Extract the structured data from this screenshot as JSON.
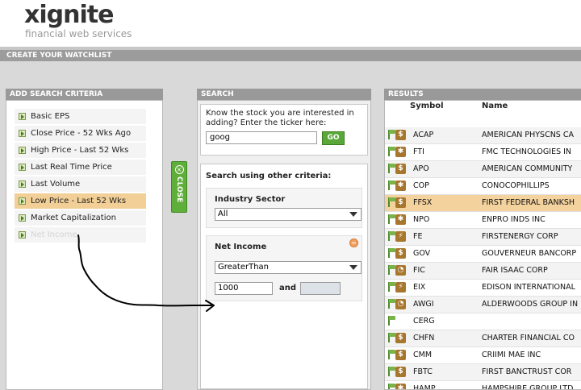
{
  "brand": {
    "logo": "xignite",
    "tagline": "financial web services"
  },
  "title_bar": "CREATE YOUR WATCHLIST",
  "criteria_panel": {
    "heading": "ADD SEARCH CRITERIA",
    "items": [
      {
        "label": "Basic EPS",
        "selected": false
      },
      {
        "label": "Close Price - 52 Wks Ago",
        "selected": false
      },
      {
        "label": "High Price - Last 52 Wks",
        "selected": false
      },
      {
        "label": "Last Real Time Price",
        "selected": false
      },
      {
        "label": "Last Volume",
        "selected": false
      },
      {
        "label": "Low Price - Last 52 Wks",
        "selected": true
      },
      {
        "label": "Market Capitalization",
        "selected": false
      },
      {
        "label": "Net Income",
        "selected": false
      }
    ]
  },
  "close_tab": {
    "label": "CLOSE"
  },
  "search_panel": {
    "heading": "SEARCH",
    "prompt": "Know the stock you are interested in adding? Enter the ticker here:",
    "ticker_value": "goog",
    "go_label": "GO",
    "other_criteria_title": "Search using other criteria:",
    "industry": {
      "title": "Industry Sector",
      "value": "All"
    },
    "net_income": {
      "title": "Net Income",
      "operator": "GreaterThan",
      "value1": "1000",
      "and_label": "and",
      "value2": ""
    }
  },
  "results_panel": {
    "heading": "RESULTS",
    "columns": {
      "symbol": "Symbol",
      "name": "Name"
    },
    "rows": [
      {
        "symbol": "ACAP",
        "name": "AMERICAN PHYSCNS CA",
        "type": "$"
      },
      {
        "symbol": "FTI",
        "name": "FMC TECHNOLOGIES IN",
        "type": "gear"
      },
      {
        "symbol": "APO",
        "name": "AMERICAN COMMUNITY",
        "type": "$"
      },
      {
        "symbol": "COP",
        "name": "CONOCOPHILLIPS",
        "type": "gear"
      },
      {
        "symbol": "FFSX",
        "name": "FIRST FEDERAL BANKSH",
        "type": "$"
      },
      {
        "symbol": "NPO",
        "name": "ENPRO INDS INC",
        "type": "gear"
      },
      {
        "symbol": "FE",
        "name": "FIRSTENERGY CORP",
        "type": "bolt"
      },
      {
        "symbol": "GOV",
        "name": "GOUVERNEUR BANCORP",
        "type": "$"
      },
      {
        "symbol": "FIC",
        "name": "FAIR ISAAC CORP",
        "type": "pie"
      },
      {
        "symbol": "EIX",
        "name": "EDISON INTERNATIONAL",
        "type": "bolt"
      },
      {
        "symbol": "AWGI",
        "name": "ALDERWOODS GROUP IN",
        "type": "pie"
      },
      {
        "symbol": "CERG",
        "name": "",
        "type": "none"
      },
      {
        "symbol": "CHFN",
        "name": "CHARTER FINANCIAL CO",
        "type": "$"
      },
      {
        "symbol": "CMM",
        "name": "CRIIMI MAE INC",
        "type": "$"
      },
      {
        "symbol": "FBTC",
        "name": "FIRST BANCTRUST COR",
        "type": "$"
      },
      {
        "symbol": "HAMP",
        "name": "HAMPSHIRE GROUP LTD",
        "type": "gear"
      }
    ]
  }
}
